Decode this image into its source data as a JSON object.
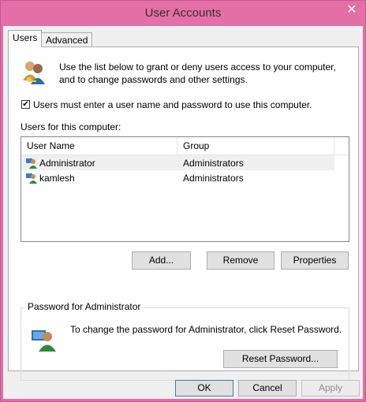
{
  "window": {
    "title": "User Accounts",
    "close_glyph": "✕"
  },
  "tabs": [
    {
      "label": "Users",
      "active": true
    },
    {
      "label": "Advanced",
      "active": false
    }
  ],
  "users_tab": {
    "intro_line1": "Use the list below to grant or deny users access to your computer,",
    "intro_line2": "and to change passwords and other settings.",
    "checkbox": {
      "label": "Users must enter a user name and password to use this computer.",
      "checked": true,
      "glyph": "✔"
    },
    "users_label": "Users for this computer:",
    "columns": [
      "User Name",
      "Group"
    ],
    "rows": [
      {
        "name": "Administrator",
        "group": "Administrators",
        "selected": true
      },
      {
        "name": "kamlesh",
        "group": "Administrators",
        "selected": false
      }
    ],
    "buttons": {
      "add": "Add...",
      "remove": "Remove",
      "properties": "Properties"
    },
    "password_group": {
      "title": "Password for Administrator",
      "text": "To change the password for Administrator, click Reset Password.",
      "reset_button": "Reset Password..."
    }
  },
  "dialog_buttons": {
    "ok": "OK",
    "cancel": "Cancel",
    "apply": "Apply"
  },
  "icons": {
    "users": "users-icon",
    "user": "user-icon",
    "admin": "admin-user-icon",
    "close": "close-icon"
  },
  "colors": {
    "title_bar": "#e36fa6",
    "client": "#f0f0f0",
    "selected_row": "#f0f0f0"
  }
}
